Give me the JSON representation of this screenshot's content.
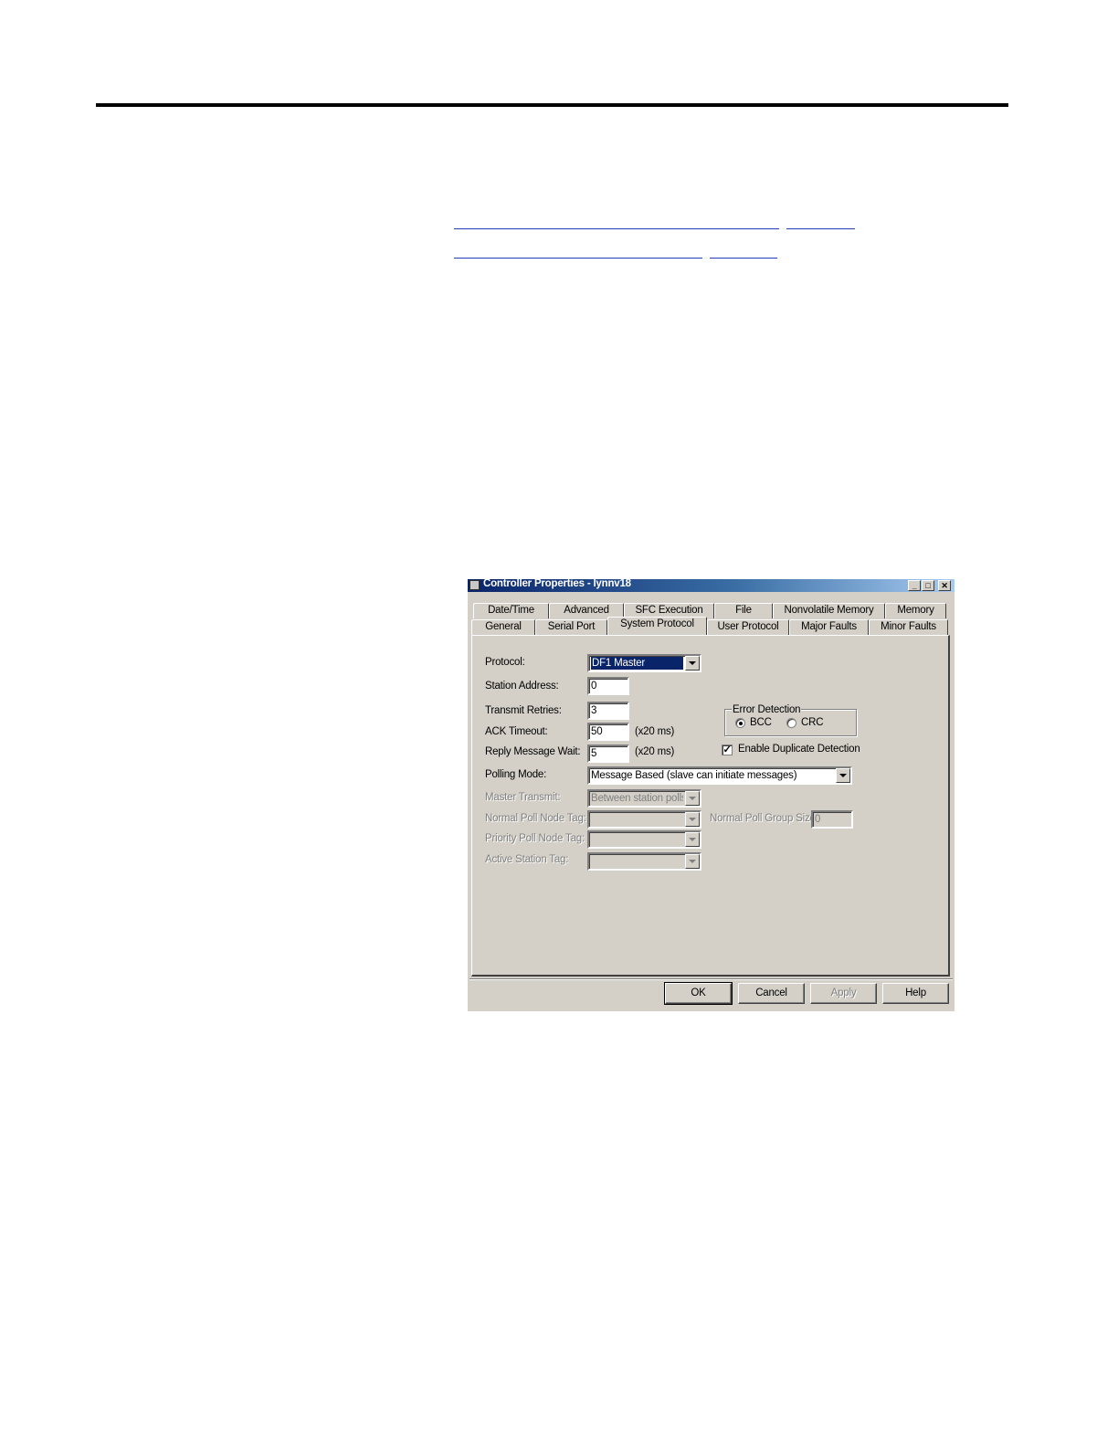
{
  "dialog": {
    "title": "Controller Properties - lynnv18",
    "controls": {
      "minimize": "_",
      "maximize": "□",
      "close": "✕"
    },
    "tabs_row1": [
      "Date/Time",
      "Advanced",
      "SFC Execution",
      "File",
      "Nonvolatile Memory",
      "Memory"
    ],
    "tabs_row2": [
      "General",
      "Serial Port",
      "System Protocol",
      "User Protocol",
      "Major Faults",
      "Minor Faults"
    ],
    "active_tab": "System Protocol",
    "form": {
      "protocol_label": "Protocol:",
      "protocol_value": "DF1 Master",
      "station_address_label": "Station Address:",
      "station_address_value": "0",
      "transmit_retries_label": "Transmit Retries:",
      "transmit_retries_value": "3",
      "ack_timeout_label": "ACK Timeout:",
      "ack_timeout_value": "50",
      "ack_timeout_unit": "(x20 ms)",
      "reply_wait_label": "Reply Message Wait:",
      "reply_wait_value": "5",
      "reply_wait_unit": "(x20 ms)",
      "polling_mode_label": "Polling Mode:",
      "polling_mode_value": "Message Based (slave can initiate messages)",
      "master_transmit_label": "Master Transmit:",
      "master_transmit_value": "Between station polls",
      "normal_poll_node_tag_label": "Normal Poll Node Tag:",
      "normal_poll_node_tag_value": "",
      "normal_poll_group_size_label": "Normal Poll Group Size:",
      "normal_poll_group_size_value": "0",
      "priority_poll_node_tag_label": "Priority Poll Node Tag:",
      "priority_poll_node_tag_value": "",
      "active_station_tag_label": "Active Station Tag:",
      "active_station_tag_value": "",
      "error_detection_label": "Error Detection",
      "bcc_label": "BCC",
      "crc_label": "CRC",
      "error_detection_selected": "BCC",
      "duplicate_detection_label": "Enable Duplicate Detection",
      "duplicate_detection_checked": true
    },
    "buttons": {
      "ok": "OK",
      "cancel": "Cancel",
      "apply": "Apply",
      "help": "Help"
    }
  }
}
